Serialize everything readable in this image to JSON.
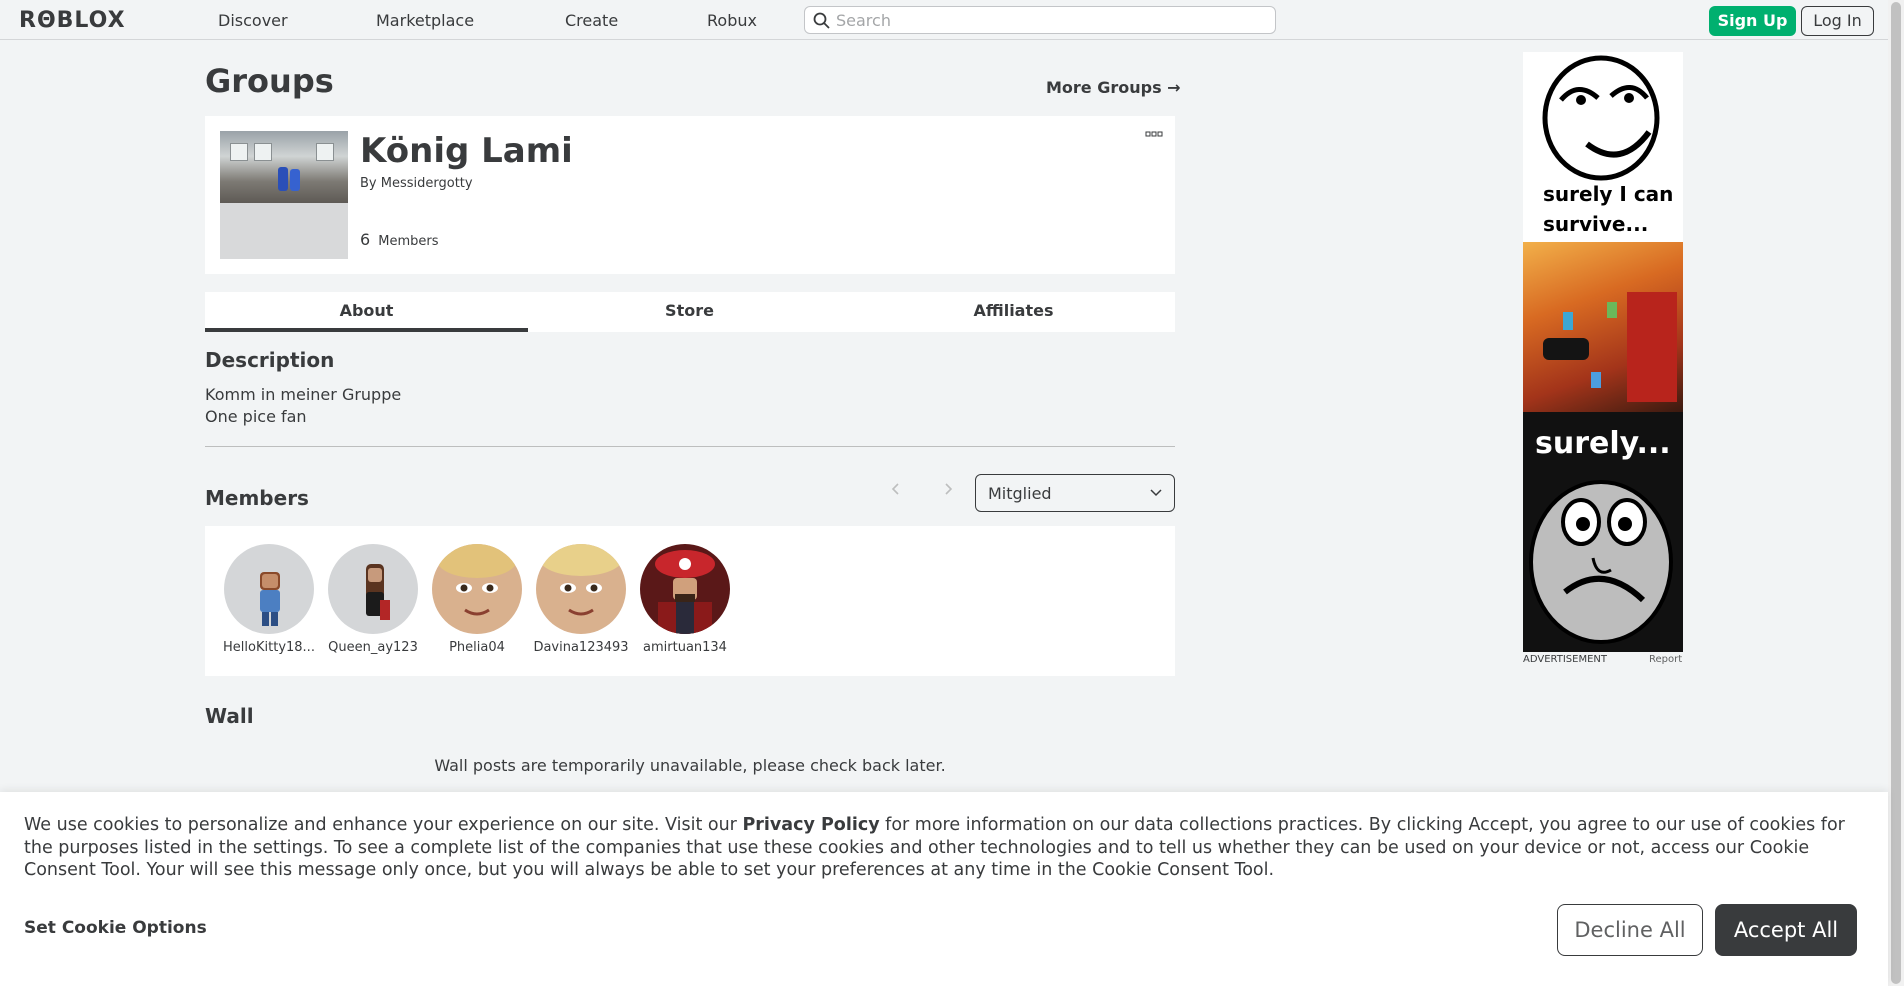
{
  "nav": {
    "logo": "RΘBLOX",
    "links": [
      "Discover",
      "Marketplace",
      "Create",
      "Robux"
    ],
    "search_placeholder": "Search",
    "signup": "Sign Up",
    "login": "Log In"
  },
  "page": {
    "title": "Groups",
    "more_groups": "More Groups →"
  },
  "group": {
    "name": "König Lami",
    "by_label": "By",
    "owner": "Messidergotty",
    "member_count": "6",
    "member_label": "Members",
    "menu_icon": "ellipsis-icon"
  },
  "tabs": [
    "About",
    "Store",
    "Affiliates"
  ],
  "about": {
    "description_title": "Description",
    "description_lines": [
      "Komm in meiner Gruppe",
      "One pice fan"
    ],
    "members_title": "Members",
    "role_selected": "Mitglied",
    "members": [
      {
        "name": "HelloKitty18..."
      },
      {
        "name": "Queen_ay123"
      },
      {
        "name": "Phelia04"
      },
      {
        "name": "Davina123493"
      },
      {
        "name": "amirtuan134"
      }
    ],
    "wall_title": "Wall",
    "wall_message": "Wall posts are temporarily unavailable, please check back later."
  },
  "ad": {
    "caption1_line1": "surely I can",
    "caption1_line2": "survive...",
    "caption2": "surely...",
    "label": "ADVERTISEMENT",
    "report": "Report"
  },
  "cookie": {
    "text_before": "We use cookies to personalize and enhance your experience on our site. Visit our ",
    "link": "Privacy Policy",
    "text_after": " for more information on our data collections practices. By clicking Accept, you agree to our use of cookies for the purposes listed in the settings. To see a complete list of the companies that use these cookies and other technologies and to tell us whether they can be used on your device or not, access our Cookie Consent Tool. Your will see this message only once, but you will always be able to set your preferences at any time in the Cookie Consent Tool.",
    "set_options": "Set Cookie Options",
    "decline": "Decline All",
    "accept": "Accept All"
  },
  "colors": {
    "accent_green": "#00b06f",
    "text_dark": "#393b3d",
    "background": "#f2f4f5"
  }
}
